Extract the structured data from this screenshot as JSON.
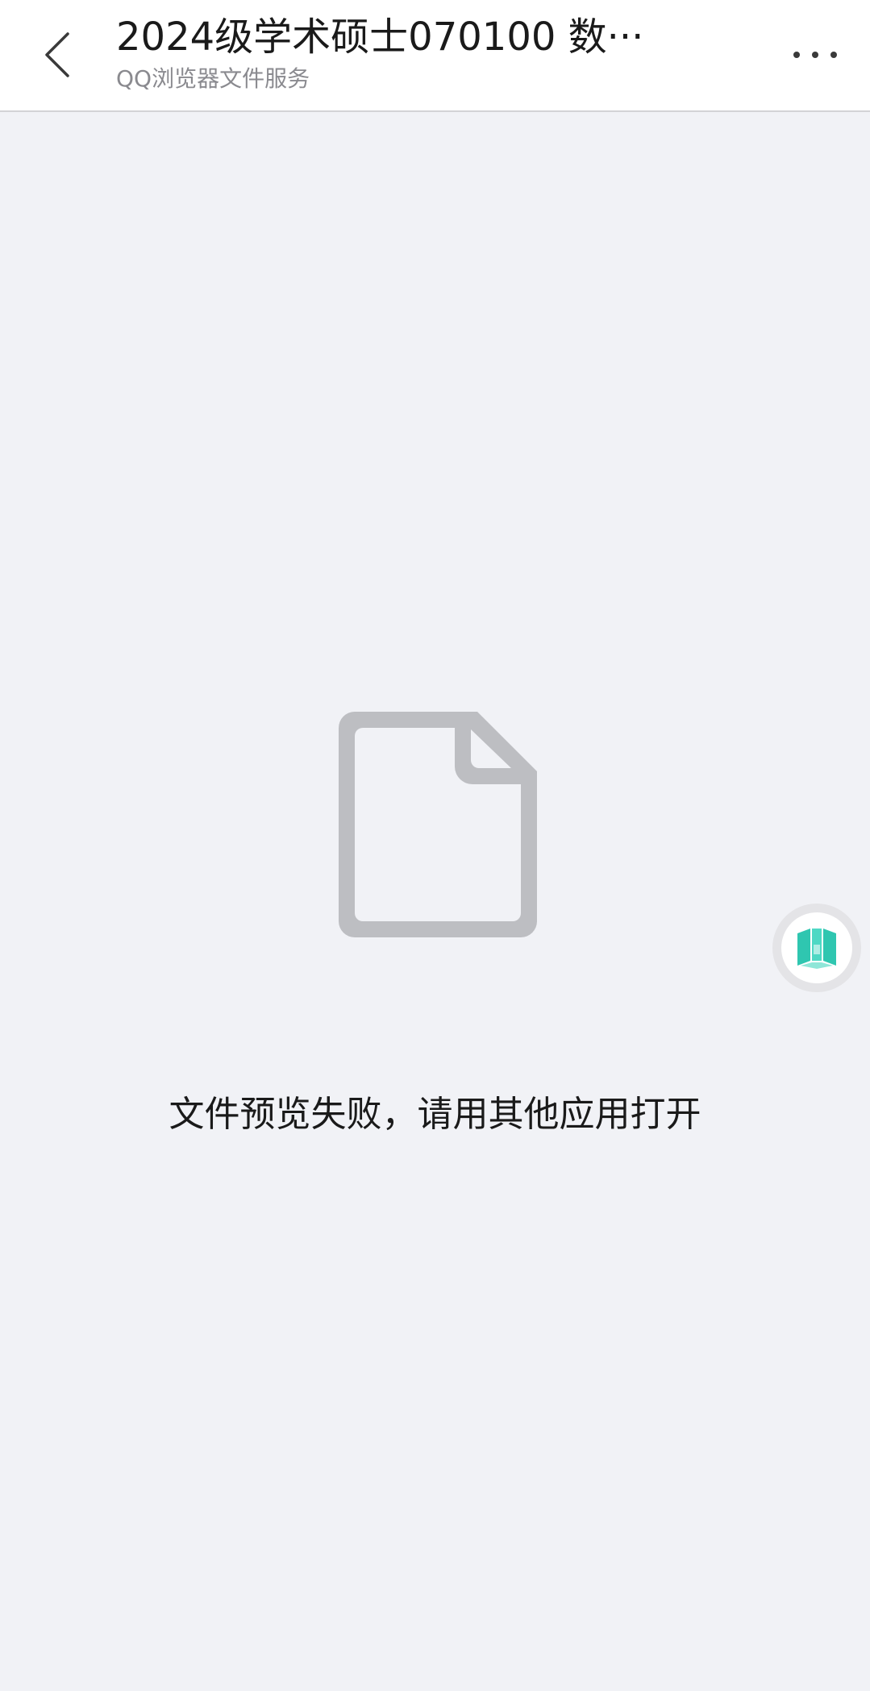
{
  "header": {
    "title": "2024级学术硕士070100 数···",
    "subtitle": "QQ浏览器文件服务",
    "back_icon": "chevron-left-icon",
    "more_icon": "more-dots-icon"
  },
  "main": {
    "icon": "document-icon",
    "message": "文件预览失败，请用其他应用打开"
  },
  "floating_button": {
    "icon": "cube-app-icon",
    "accent_color": "#3ccfb4"
  },
  "colors": {
    "background": "#f1f2f6",
    "header_background": "#ffffff",
    "icon_gray": "#bdbec2"
  }
}
